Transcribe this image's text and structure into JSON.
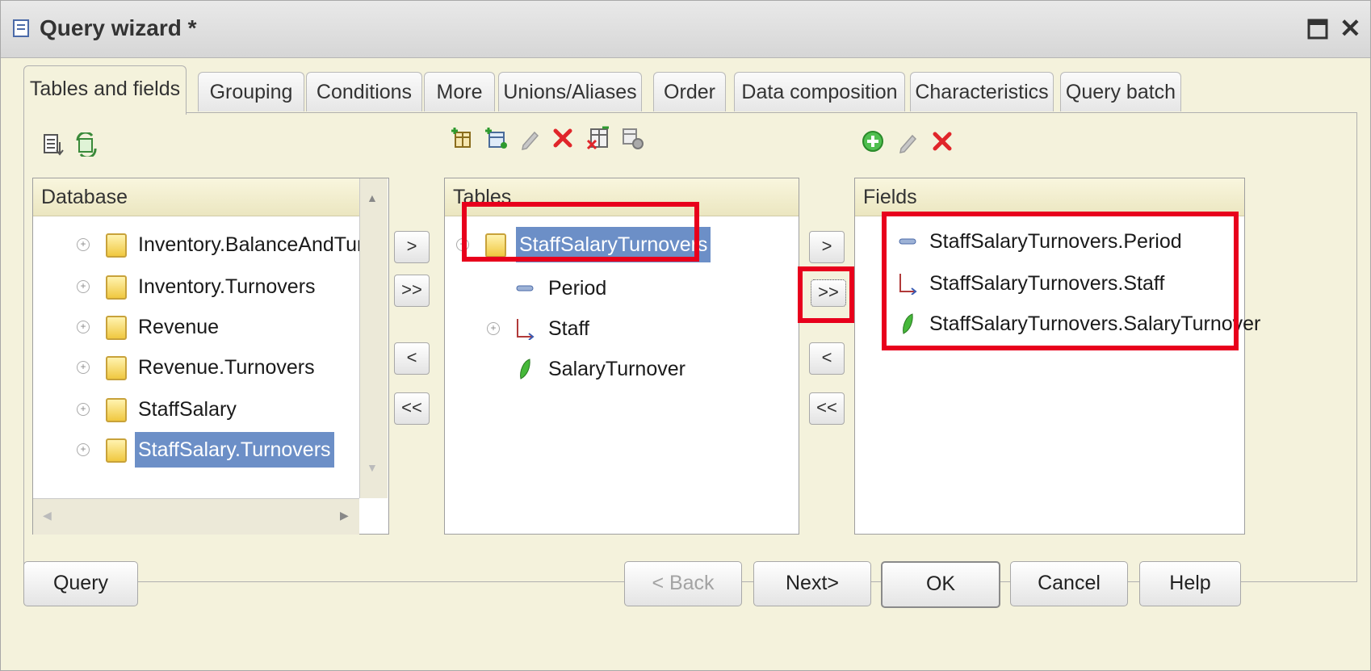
{
  "window": {
    "title": "Query wizard *"
  },
  "tabs": [
    {
      "label": "Tables and fields"
    },
    {
      "label": "Grouping"
    },
    {
      "label": "Conditions"
    },
    {
      "label": "More"
    },
    {
      "label": "Unions/Aliases"
    },
    {
      "label": "Order"
    },
    {
      "label": "Data composition"
    },
    {
      "label": "Characteristics"
    },
    {
      "label": "Query batch"
    }
  ],
  "database": {
    "header": "Database",
    "items": [
      {
        "label": "Inventory.BalanceAndTurnovers"
      },
      {
        "label": "Inventory.Turnovers"
      },
      {
        "label": "Revenue"
      },
      {
        "label": "Revenue.Turnovers"
      },
      {
        "label": "StaffSalary"
      },
      {
        "label": "StaffSalary.Turnovers"
      }
    ]
  },
  "tables": {
    "header": "Tables",
    "root": "StaffSalaryTurnovers",
    "children": [
      {
        "label": "Period",
        "icon": "dimension-period-icon"
      },
      {
        "label": "Staff",
        "icon": "reference-axis-icon"
      },
      {
        "label": "SalaryTurnover",
        "icon": "resource-leaf-icon"
      }
    ]
  },
  "fields": {
    "header": "Fields",
    "items": [
      {
        "label": "StaffSalaryTurnovers.Period"
      },
      {
        "label": "StaffSalaryTurnovers.Staff"
      },
      {
        "label": "StaffSalaryTurnovers.SalaryTurnover"
      }
    ]
  },
  "move_buttons": {
    "add": ">",
    "add_all": ">>",
    "remove": "<",
    "remove_all": "<<"
  },
  "buttons": {
    "query": "Query",
    "back": "< Back",
    "next": "Next>",
    "ok": "OK",
    "cancel": "Cancel",
    "help": "Help"
  },
  "colors": {
    "selection": "#6c8fc7",
    "highlight_frame": "#e8001c",
    "background": "#f4f2dc"
  }
}
